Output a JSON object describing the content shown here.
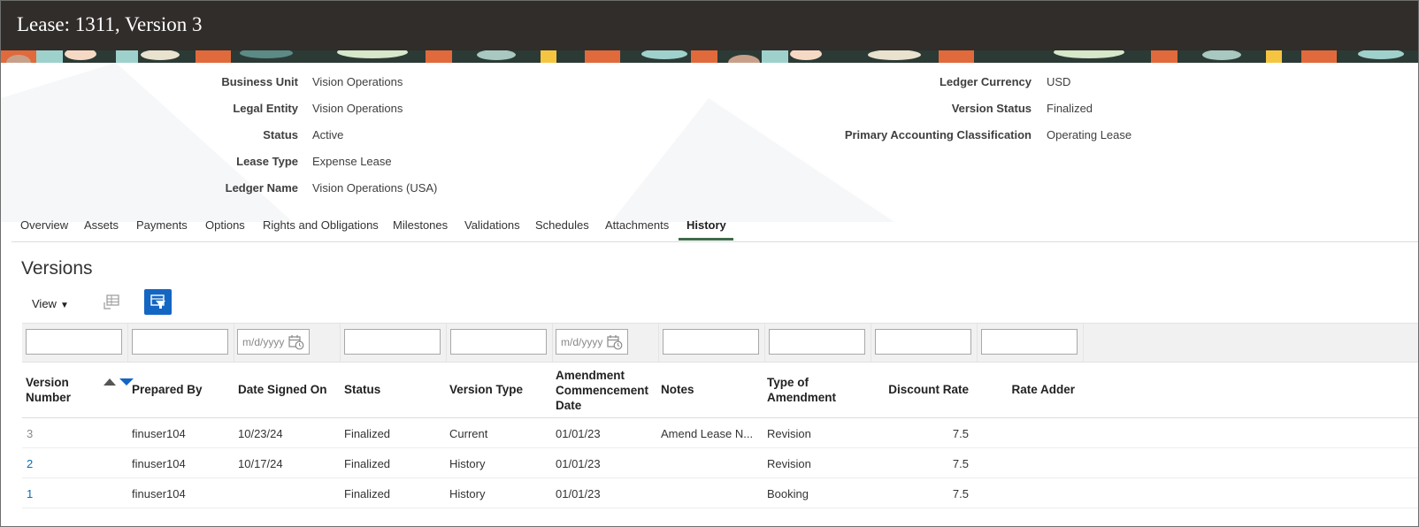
{
  "header": {
    "title": "Lease: 1311, Version 3"
  },
  "details": {
    "left": [
      {
        "label": "Business Unit",
        "value": "Vision Operations"
      },
      {
        "label": "Legal Entity",
        "value": "Vision Operations"
      },
      {
        "label": "Status",
        "value": "Active"
      },
      {
        "label": "Lease Type",
        "value": "Expense Lease"
      },
      {
        "label": "Ledger Name",
        "value": "Vision Operations (USA)"
      }
    ],
    "right": [
      {
        "label": "Ledger Currency",
        "value": "USD"
      },
      {
        "label": "Version Status",
        "value": "Finalized"
      },
      {
        "label": "Primary Accounting Classification",
        "value": "Operating Lease"
      }
    ]
  },
  "tabs": [
    {
      "label": "Overview"
    },
    {
      "label": "Assets"
    },
    {
      "label": "Payments"
    },
    {
      "label": "Options"
    },
    {
      "label": "Rights and Obligations"
    },
    {
      "label": "Milestones"
    },
    {
      "label": "Validations"
    },
    {
      "label": "Schedules"
    },
    {
      "label": "Attachments"
    },
    {
      "label": "History",
      "active": true
    }
  ],
  "versions": {
    "title": "Versions",
    "view_label": "View",
    "date_placeholder": "m/d/yyyy",
    "columns": {
      "version_number": [
        "Version",
        "Number"
      ],
      "prepared_by": "Prepared By",
      "date_signed_on": "Date Signed On",
      "status": "Status",
      "version_type": "Version Type",
      "amendment_commencement_date": [
        "Amendment",
        "Commencement",
        "Date"
      ],
      "notes": "Notes",
      "type_of_amendment": [
        "Type of",
        "Amendment"
      ],
      "discount_rate": "Discount Rate",
      "rate_adder": "Rate Adder"
    },
    "rows": [
      {
        "version": "3",
        "prepared_by": "finuser104",
        "date_signed": "10/23/24",
        "status": "Finalized",
        "version_type": "Current",
        "amend_date": "01/01/23",
        "notes": "Amend Lease N...",
        "type_of_amendment": "Revision",
        "discount_rate": "7.5",
        "rate_adder": ""
      },
      {
        "version": "2",
        "prepared_by": "finuser104",
        "date_signed": "10/17/24",
        "status": "Finalized",
        "version_type": "History",
        "amend_date": "01/01/23",
        "notes": "",
        "type_of_amendment": "Revision",
        "discount_rate": "7.5",
        "rate_adder": ""
      },
      {
        "version": "1",
        "prepared_by": "finuser104",
        "date_signed": "",
        "status": "Finalized",
        "version_type": "History",
        "amend_date": "01/01/23",
        "notes": "",
        "type_of_amendment": "Booking",
        "discount_rate": "7.5",
        "rate_adder": ""
      }
    ]
  },
  "colors": {
    "header_bg": "#312d2a",
    "link": "#0b6db4",
    "accent": "#1466c3",
    "active_tab_underline": "#3f6b4a"
  }
}
